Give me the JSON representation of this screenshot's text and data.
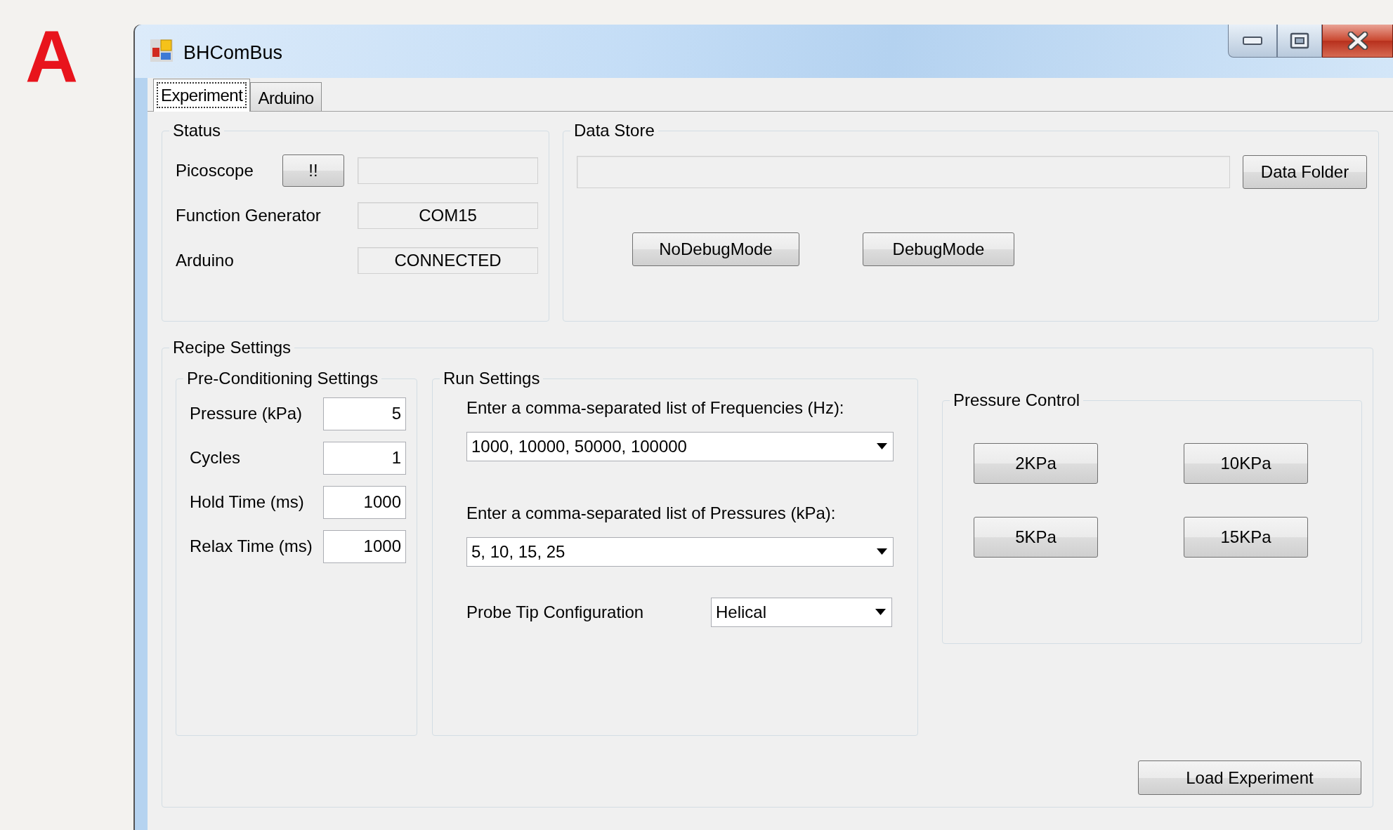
{
  "figure_label": "A",
  "window": {
    "title": "BHComBus"
  },
  "tabs": [
    {
      "label": "Experiment",
      "selected": true
    },
    {
      "label": "Arduino",
      "selected": false
    }
  ],
  "status": {
    "title": "Status",
    "rows": [
      {
        "kind": "button",
        "label": "Picoscope",
        "button": "!!"
      },
      {
        "kind": "field",
        "label": "Function Generator",
        "value": "COM15"
      },
      {
        "kind": "field",
        "label": "Arduino",
        "value": "CONNECTED"
      }
    ]
  },
  "data_store": {
    "title": "Data Store",
    "button": "Data Folder",
    "mode_buttons": [
      "NoDebugMode",
      "DebugMode"
    ]
  },
  "recipe": {
    "title": "Recipe Settings",
    "preconditioning": {
      "title": "Pre-Conditioning Settings",
      "fields": [
        {
          "label": "Pressure (kPa)",
          "value": "5"
        },
        {
          "label": "Cycles",
          "value": "1"
        },
        {
          "label": "Hold Time (ms)",
          "value": "1000"
        },
        {
          "label": "Relax Time (ms)",
          "value": "1000"
        }
      ]
    },
    "run_settings": {
      "title": "Run Settings",
      "frequencies": {
        "label": "Enter a comma-separated list of Frequencies (Hz):",
        "value": "1000, 10000, 50000, 100000"
      },
      "pressures": {
        "label": "Enter a comma-separated list of Pressures (kPa):",
        "value": "5, 10, 15, 25"
      },
      "probe_tip": {
        "label": "Probe Tip Configuration",
        "value": "Helical"
      }
    },
    "pressure_control": {
      "title": "Pressure Control",
      "buttons": [
        "2KPa",
        "10KPa",
        "5KPa",
        "15KPa"
      ]
    },
    "load_button": "Load Experiment"
  }
}
